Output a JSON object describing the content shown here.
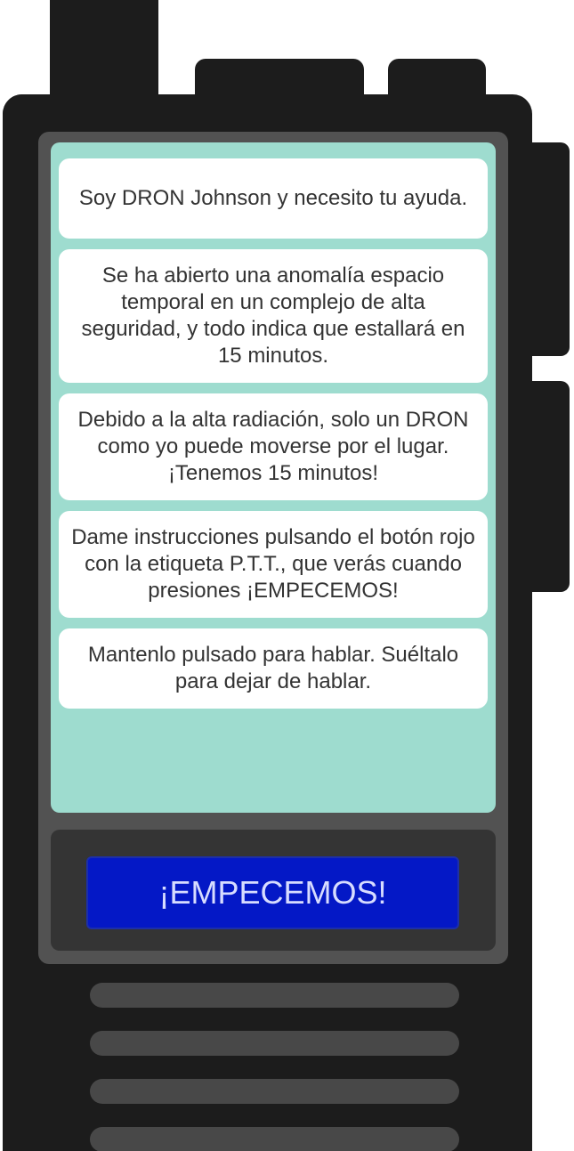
{
  "messages": [
    "Soy DRON Johnson y necesito tu ayuda.",
    "Se ha abierto una anomalía espacio temporal en un complejo de alta seguridad, y todo indica que estallará en 15 minutos.",
    "Debido a la alta radiación, solo un DRON como yo puede moverse por el lugar. ¡Tenemos 15 minutos!",
    "Dame instrucciones pulsando el botón rojo con la etiqueta P.T.T., que verás cuando presiones ¡EMPECEMOS!",
    "Mantenlo pulsado para hablar. Suéltalo para dejar de hablar."
  ],
  "start_button": {
    "label": "¡EMPECEMOS!"
  },
  "colors": {
    "radio_body": "#1c1c1c",
    "face_plate": "#525252",
    "screen": "#9edccf",
    "bubble": "#ffffff",
    "button_background": "#0418c6",
    "button_text": "#d7dcff",
    "grille": "#484848"
  }
}
